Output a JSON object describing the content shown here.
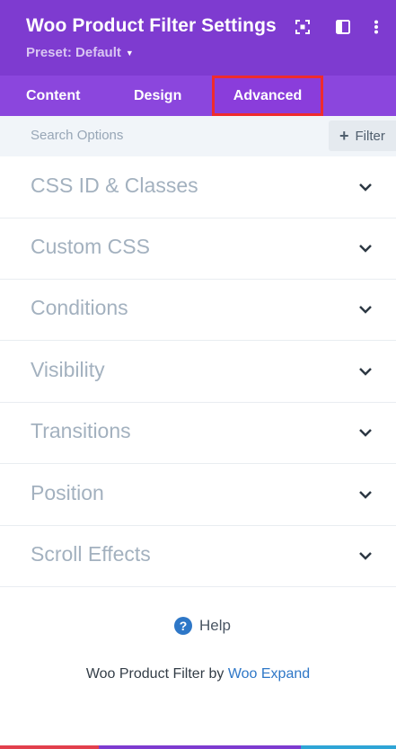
{
  "header": {
    "title": "Woo Product Filter Settings",
    "preset": "Preset: Default",
    "bg_color": "#7e3bd0"
  },
  "tabs": [
    {
      "label": "Content"
    },
    {
      "label": "Design"
    },
    {
      "label": "Advanced",
      "active": true
    }
  ],
  "search": {
    "placeholder": "Search Options",
    "filter_label": "Filter"
  },
  "sections": [
    {
      "label": "CSS ID & Classes"
    },
    {
      "label": "Custom CSS"
    },
    {
      "label": "Conditions"
    },
    {
      "label": "Visibility"
    },
    {
      "label": "Transitions"
    },
    {
      "label": "Position"
    },
    {
      "label": "Scroll Effects"
    }
  ],
  "help": {
    "label": "Help"
  },
  "footer": {
    "prefix": "Woo Product Filter by",
    "link": "Woo Expand"
  },
  "colors": {
    "accent": "#7e3bd0",
    "link": "#2e77c7",
    "highlight": "#ef2b2d"
  }
}
